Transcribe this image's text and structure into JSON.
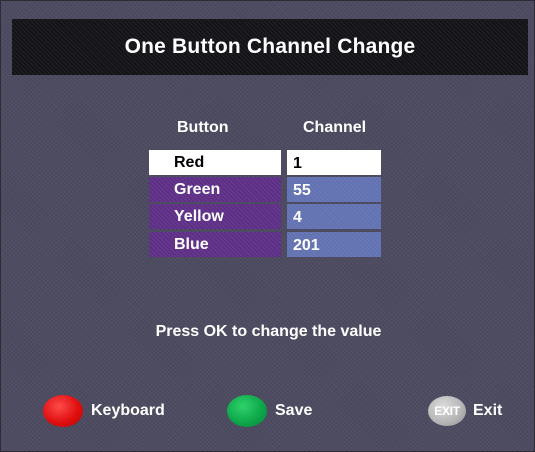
{
  "title": "One Button Channel Change",
  "columns": {
    "button": "Button",
    "channel": "Channel"
  },
  "rows": [
    {
      "button": "Red",
      "channel": "1",
      "selected": true
    },
    {
      "button": "Green",
      "channel": "55",
      "selected": false
    },
    {
      "button": "Yellow",
      "channel": "4",
      "selected": false
    },
    {
      "button": "Blue",
      "channel": "201",
      "selected": false
    }
  ],
  "instruction": "Press OK to change the value",
  "footer": {
    "keyboard": {
      "label": "Keyboard",
      "icon": "red-button-icon",
      "color": "#e01010"
    },
    "save": {
      "label": "Save",
      "icon": "green-button-icon",
      "color": "#0ea84a"
    },
    "exit": {
      "label": "Exit",
      "icon_text": "EXIT",
      "icon": "exit-button-icon"
    }
  },
  "colors": {
    "background": "#4d4b60",
    "title_bar": "#141418",
    "button_cell": "#5e2f86",
    "channel_cell": "#6272b2",
    "selected_cell": "#ffffff"
  }
}
